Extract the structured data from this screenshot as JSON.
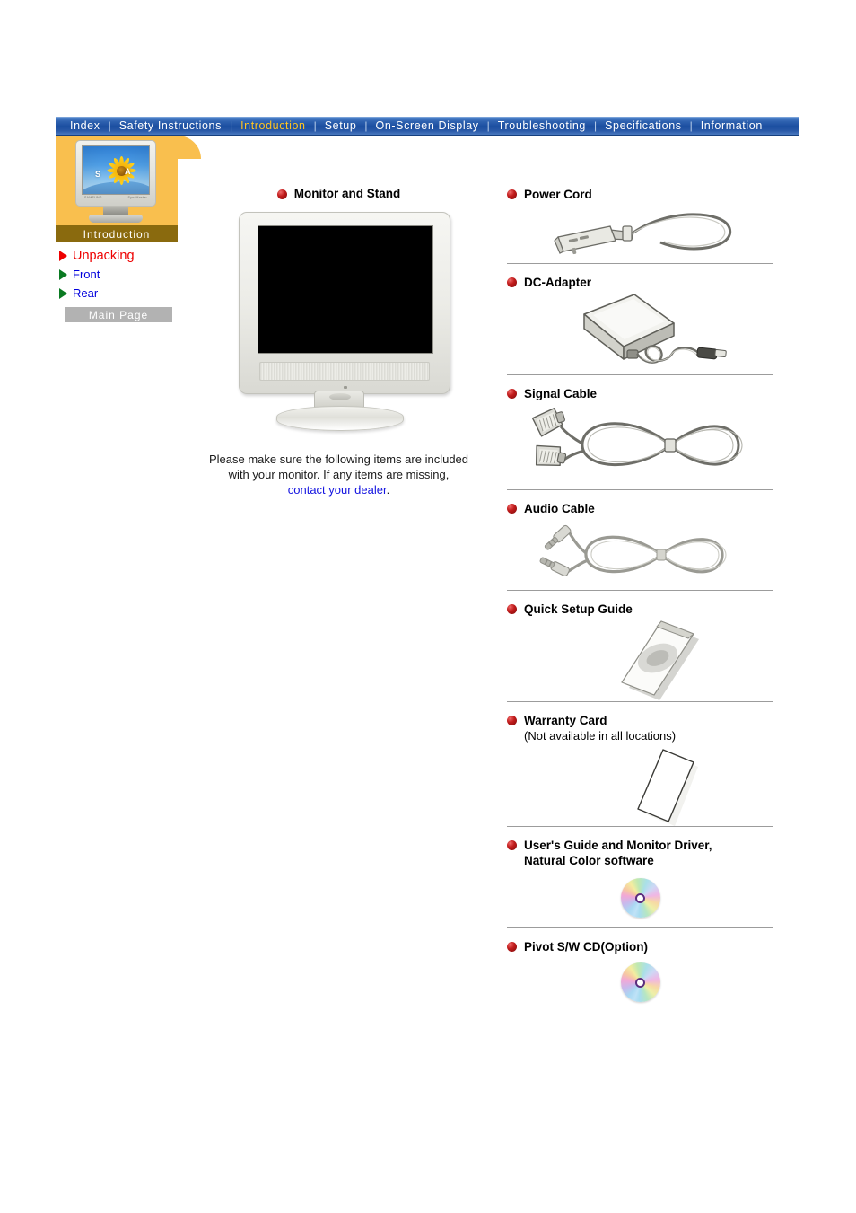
{
  "nav": {
    "items": [
      {
        "label": "Index",
        "active": false
      },
      {
        "label": "Safety Instructions",
        "active": false
      },
      {
        "label": "Introduction",
        "active": true
      },
      {
        "label": "Setup",
        "active": false
      },
      {
        "label": "On-Screen Display",
        "active": false
      },
      {
        "label": "Troubleshooting",
        "active": false
      },
      {
        "label": "Specifications",
        "active": false
      },
      {
        "label": "Information",
        "active": false
      }
    ],
    "separator": "|",
    "active_color": "#ffc422",
    "text_color": "#ffffff",
    "bar_color": "#1b4ea0"
  },
  "sidebar": {
    "tab_label": "Introduction",
    "thumbnail": {
      "letter_s": "S",
      "letter_a": "A",
      "brand_left": "SAMSUNG",
      "brand_right": "SyncMaster"
    },
    "links": [
      {
        "label": "Unpacking",
        "active": true,
        "marker_color": "#ee0000",
        "text_color": "#ee0000"
      },
      {
        "label": "Front",
        "active": false,
        "marker_color": "#0a7a22",
        "text_color": "#0000dd"
      },
      {
        "label": "Rear",
        "active": false,
        "marker_color": "#0a7a22",
        "text_color": "#0000dd"
      }
    ],
    "main_page_button": "Main Page"
  },
  "center": {
    "heading": "Monitor and Stand",
    "note_line1": "Please make sure the following items are included",
    "note_line2": "with your monitor. If any items are missing,",
    "note_link": "contact your dealer",
    "note_end": "."
  },
  "accessories": [
    {
      "title": "Power Cord",
      "subtitle": "",
      "art": "power-cord-illustration"
    },
    {
      "title": "DC-Adapter",
      "subtitle": "",
      "art": "dc-adapter-illustration"
    },
    {
      "title": "Signal Cable",
      "subtitle": "",
      "art": "signal-cable-illustration"
    },
    {
      "title": "Audio Cable",
      "subtitle": "",
      "art": "audio-cable-illustration"
    },
    {
      "title": "Quick Setup Guide",
      "subtitle": "",
      "art": "booklet-illustration"
    },
    {
      "title": "Warranty Card",
      "subtitle": "(Not available in all locations)",
      "art": "card-illustration"
    },
    {
      "title": "User's Guide and Monitor Driver,",
      "subtitle": "Natural Color software",
      "title_is_two_line": true,
      "art": "cd-illustration"
    },
    {
      "title": "Pivot S/W CD(Option)",
      "subtitle": "",
      "art": "cd-illustration"
    }
  ],
  "colors": {
    "bullet": "#c11c1c",
    "tab_panel": "#f9bf4e",
    "tab_label_bar": "#8a6a0e",
    "main_page_button": "#b2b2b2",
    "divider": "#9c9c9c",
    "link_blue": "#1414e0"
  }
}
